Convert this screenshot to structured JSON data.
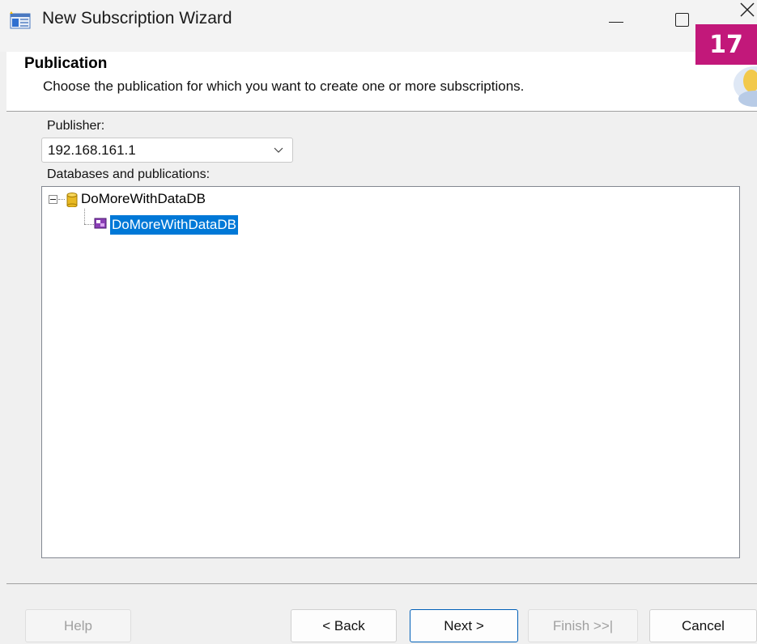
{
  "window": {
    "title": "New Subscription Wizard",
    "icon": "wizard-app-icon",
    "controls": [
      "minimize-icon",
      "maximize-icon",
      "close-icon"
    ]
  },
  "badge": {
    "number": "17",
    "color": "#c2187a"
  },
  "header": {
    "title": "Publication",
    "description": "Choose the publication for which you want to create one or more subscriptions."
  },
  "publisher": {
    "label": "Publisher:",
    "selected_value": "192.168.161.1"
  },
  "tree": {
    "label": "Databases and publications:",
    "nodes": [
      {
        "label": "DoMoreWithDataDB",
        "icon": "database-icon",
        "expanded": true,
        "children": [
          {
            "label": "DoMoreWithDataDB",
            "icon": "publication-icon",
            "selected": true
          }
        ]
      }
    ]
  },
  "buttons": {
    "help": "Help",
    "back": "< Back",
    "next": "Next >",
    "finish": "Finish >>|",
    "cancel": "Cancel"
  },
  "colors": {
    "selection": "#0078d7",
    "accent_border": "#005fb8",
    "disabled_text": "#a0a0a0"
  }
}
